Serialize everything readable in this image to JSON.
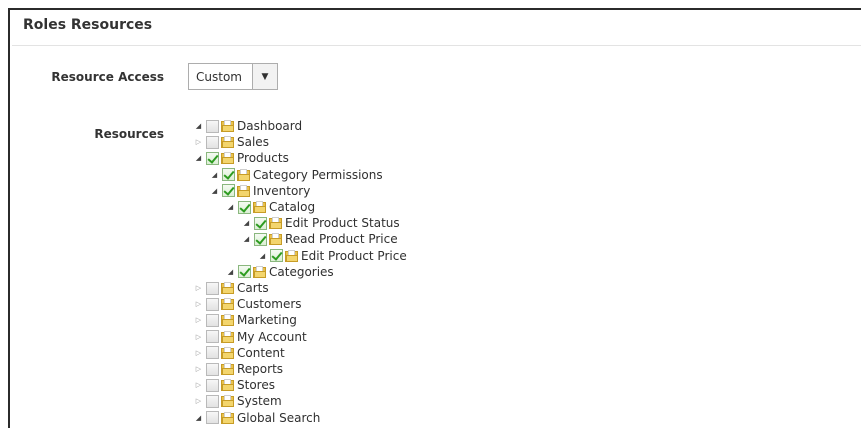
{
  "section": {
    "title": "Roles Resources"
  },
  "resource_access": {
    "label": "Resource Access",
    "value": "Custom",
    "arrow": "▼"
  },
  "resources": {
    "label": "Resources",
    "nodes": [
      {
        "label": "Dashboard",
        "checked": false,
        "expanded": true
      },
      {
        "label": "Sales",
        "checked": false,
        "expanded": false
      },
      {
        "label": "Products",
        "checked": true,
        "expanded": true
      },
      {
        "label": "Category Permissions",
        "checked": true,
        "expanded": true
      },
      {
        "label": "Inventory",
        "checked": true,
        "expanded": true
      },
      {
        "label": "Catalog",
        "checked": true,
        "expanded": true
      },
      {
        "label": "Edit Product Status",
        "checked": true,
        "expanded": true
      },
      {
        "label": "Read Product Price",
        "checked": true,
        "expanded": true
      },
      {
        "label": "Edit Product Price",
        "checked": true,
        "expanded": true
      },
      {
        "label": "Categories",
        "checked": true,
        "expanded": true
      },
      {
        "label": "Carts",
        "checked": false,
        "expanded": false
      },
      {
        "label": "Customers",
        "checked": false,
        "expanded": false
      },
      {
        "label": "Marketing",
        "checked": false,
        "expanded": false
      },
      {
        "label": "My Account",
        "checked": false,
        "expanded": false
      },
      {
        "label": "Content",
        "checked": false,
        "expanded": false
      },
      {
        "label": "Reports",
        "checked": false,
        "expanded": false
      },
      {
        "label": "Stores",
        "checked": false,
        "expanded": false
      },
      {
        "label": "System",
        "checked": false,
        "expanded": false
      },
      {
        "label": "Global Search",
        "checked": false,
        "expanded": true
      }
    ]
  }
}
